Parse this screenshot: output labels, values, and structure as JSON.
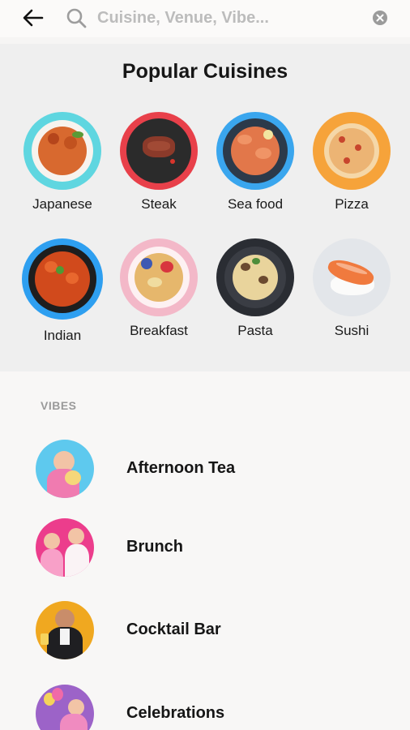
{
  "search": {
    "placeholder": "Cuisine, Venue, Vibe..."
  },
  "icons": {
    "back": "arrow-left-icon",
    "search": "search-icon",
    "clear": "clear-circle-icon"
  },
  "cuisines": {
    "title": "Popular Cuisines",
    "items": [
      {
        "label": "Japanese",
        "ring": "#5fd6e0"
      },
      {
        "label": "Steak",
        "ring": "#e8404a"
      },
      {
        "label": "Sea food",
        "ring": "#3aa6ee"
      },
      {
        "label": "Pizza",
        "ring": "#f6a33a"
      },
      {
        "label": "Indian",
        "ring": "#2e9ff0"
      },
      {
        "label": "Breakfast",
        "ring": "#f3b8c8"
      },
      {
        "label": "Pasta",
        "ring": "#2a2d33"
      },
      {
        "label": "Sushi",
        "ring": "#dfe3e7"
      }
    ]
  },
  "vibes": {
    "label": "VIBES",
    "items": [
      {
        "label": "Afternoon Tea",
        "color": "#5ec9ee"
      },
      {
        "label": "Brunch",
        "color": "#ec3d8c"
      },
      {
        "label": "Cocktail Bar",
        "color": "#f0a820"
      },
      {
        "label": "Celebrations",
        "color": "#9c63c8"
      }
    ]
  }
}
